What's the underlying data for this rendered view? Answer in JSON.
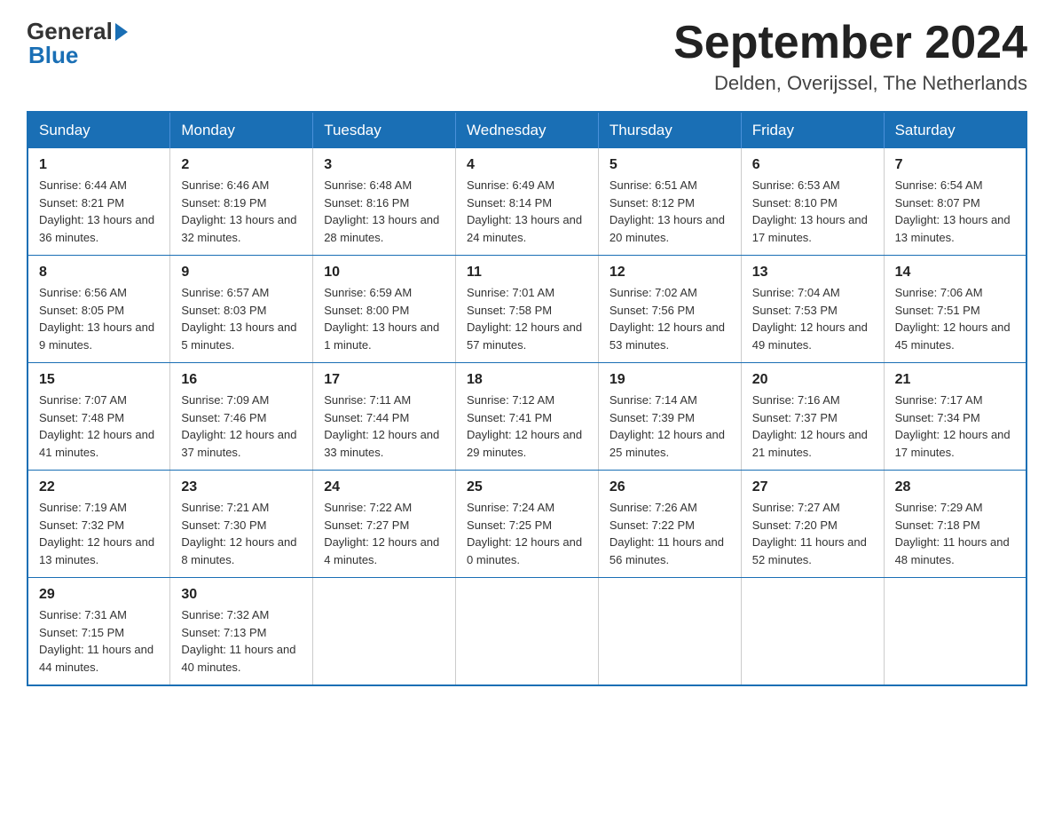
{
  "header": {
    "logo_general": "General",
    "logo_blue": "Blue",
    "title": "September 2024",
    "subtitle": "Delden, Overijssel, The Netherlands"
  },
  "days_of_week": [
    "Sunday",
    "Monday",
    "Tuesday",
    "Wednesday",
    "Thursday",
    "Friday",
    "Saturday"
  ],
  "weeks": [
    [
      {
        "day": "1",
        "sunrise": "6:44 AM",
        "sunset": "8:21 PM",
        "daylight": "13 hours and 36 minutes."
      },
      {
        "day": "2",
        "sunrise": "6:46 AM",
        "sunset": "8:19 PM",
        "daylight": "13 hours and 32 minutes."
      },
      {
        "day": "3",
        "sunrise": "6:48 AM",
        "sunset": "8:16 PM",
        "daylight": "13 hours and 28 minutes."
      },
      {
        "day": "4",
        "sunrise": "6:49 AM",
        "sunset": "8:14 PM",
        "daylight": "13 hours and 24 minutes."
      },
      {
        "day": "5",
        "sunrise": "6:51 AM",
        "sunset": "8:12 PM",
        "daylight": "13 hours and 20 minutes."
      },
      {
        "day": "6",
        "sunrise": "6:53 AM",
        "sunset": "8:10 PM",
        "daylight": "13 hours and 17 minutes."
      },
      {
        "day": "7",
        "sunrise": "6:54 AM",
        "sunset": "8:07 PM",
        "daylight": "13 hours and 13 minutes."
      }
    ],
    [
      {
        "day": "8",
        "sunrise": "6:56 AM",
        "sunset": "8:05 PM",
        "daylight": "13 hours and 9 minutes."
      },
      {
        "day": "9",
        "sunrise": "6:57 AM",
        "sunset": "8:03 PM",
        "daylight": "13 hours and 5 minutes."
      },
      {
        "day": "10",
        "sunrise": "6:59 AM",
        "sunset": "8:00 PM",
        "daylight": "13 hours and 1 minute."
      },
      {
        "day": "11",
        "sunrise": "7:01 AM",
        "sunset": "7:58 PM",
        "daylight": "12 hours and 57 minutes."
      },
      {
        "day": "12",
        "sunrise": "7:02 AM",
        "sunset": "7:56 PM",
        "daylight": "12 hours and 53 minutes."
      },
      {
        "day": "13",
        "sunrise": "7:04 AM",
        "sunset": "7:53 PM",
        "daylight": "12 hours and 49 minutes."
      },
      {
        "day": "14",
        "sunrise": "7:06 AM",
        "sunset": "7:51 PM",
        "daylight": "12 hours and 45 minutes."
      }
    ],
    [
      {
        "day": "15",
        "sunrise": "7:07 AM",
        "sunset": "7:48 PM",
        "daylight": "12 hours and 41 minutes."
      },
      {
        "day": "16",
        "sunrise": "7:09 AM",
        "sunset": "7:46 PM",
        "daylight": "12 hours and 37 minutes."
      },
      {
        "day": "17",
        "sunrise": "7:11 AM",
        "sunset": "7:44 PM",
        "daylight": "12 hours and 33 minutes."
      },
      {
        "day": "18",
        "sunrise": "7:12 AM",
        "sunset": "7:41 PM",
        "daylight": "12 hours and 29 minutes."
      },
      {
        "day": "19",
        "sunrise": "7:14 AM",
        "sunset": "7:39 PM",
        "daylight": "12 hours and 25 minutes."
      },
      {
        "day": "20",
        "sunrise": "7:16 AM",
        "sunset": "7:37 PM",
        "daylight": "12 hours and 21 minutes."
      },
      {
        "day": "21",
        "sunrise": "7:17 AM",
        "sunset": "7:34 PM",
        "daylight": "12 hours and 17 minutes."
      }
    ],
    [
      {
        "day": "22",
        "sunrise": "7:19 AM",
        "sunset": "7:32 PM",
        "daylight": "12 hours and 13 minutes."
      },
      {
        "day": "23",
        "sunrise": "7:21 AM",
        "sunset": "7:30 PM",
        "daylight": "12 hours and 8 minutes."
      },
      {
        "day": "24",
        "sunrise": "7:22 AM",
        "sunset": "7:27 PM",
        "daylight": "12 hours and 4 minutes."
      },
      {
        "day": "25",
        "sunrise": "7:24 AM",
        "sunset": "7:25 PM",
        "daylight": "12 hours and 0 minutes."
      },
      {
        "day": "26",
        "sunrise": "7:26 AM",
        "sunset": "7:22 PM",
        "daylight": "11 hours and 56 minutes."
      },
      {
        "day": "27",
        "sunrise": "7:27 AM",
        "sunset": "7:20 PM",
        "daylight": "11 hours and 52 minutes."
      },
      {
        "day": "28",
        "sunrise": "7:29 AM",
        "sunset": "7:18 PM",
        "daylight": "11 hours and 48 minutes."
      }
    ],
    [
      {
        "day": "29",
        "sunrise": "7:31 AM",
        "sunset": "7:15 PM",
        "daylight": "11 hours and 44 minutes."
      },
      {
        "day": "30",
        "sunrise": "7:32 AM",
        "sunset": "7:13 PM",
        "daylight": "11 hours and 40 minutes."
      },
      null,
      null,
      null,
      null,
      null
    ]
  ],
  "labels": {
    "sunrise": "Sunrise:",
    "sunset": "Sunset:",
    "daylight": "Daylight:"
  }
}
